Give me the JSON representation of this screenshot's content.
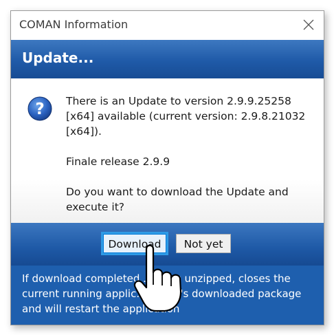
{
  "window": {
    "title": "COMAN Information",
    "close_icon": "close-icon"
  },
  "header": {
    "title": "Update..."
  },
  "message": {
    "icon": "question-icon",
    "line1": "There is an Update to version 2.9.9.25258 [x64] available (current version: 2.9.8.21032 [x64]).",
    "line2": "Finale release 2.9.9",
    "line3": "Do you want to download the Update and execute it?"
  },
  "buttons": {
    "download_label": "Download",
    "not_yet_label": "Not yet"
  },
  "footer": {
    "text": "If download completed ... get's unzipped, closes the current running applic... install's downloaded package and will restart the application"
  },
  "colors": {
    "header_blue": "#1f5aa8",
    "footer_blue": "#1e5fae",
    "focus_ring": "#2f9be6"
  }
}
